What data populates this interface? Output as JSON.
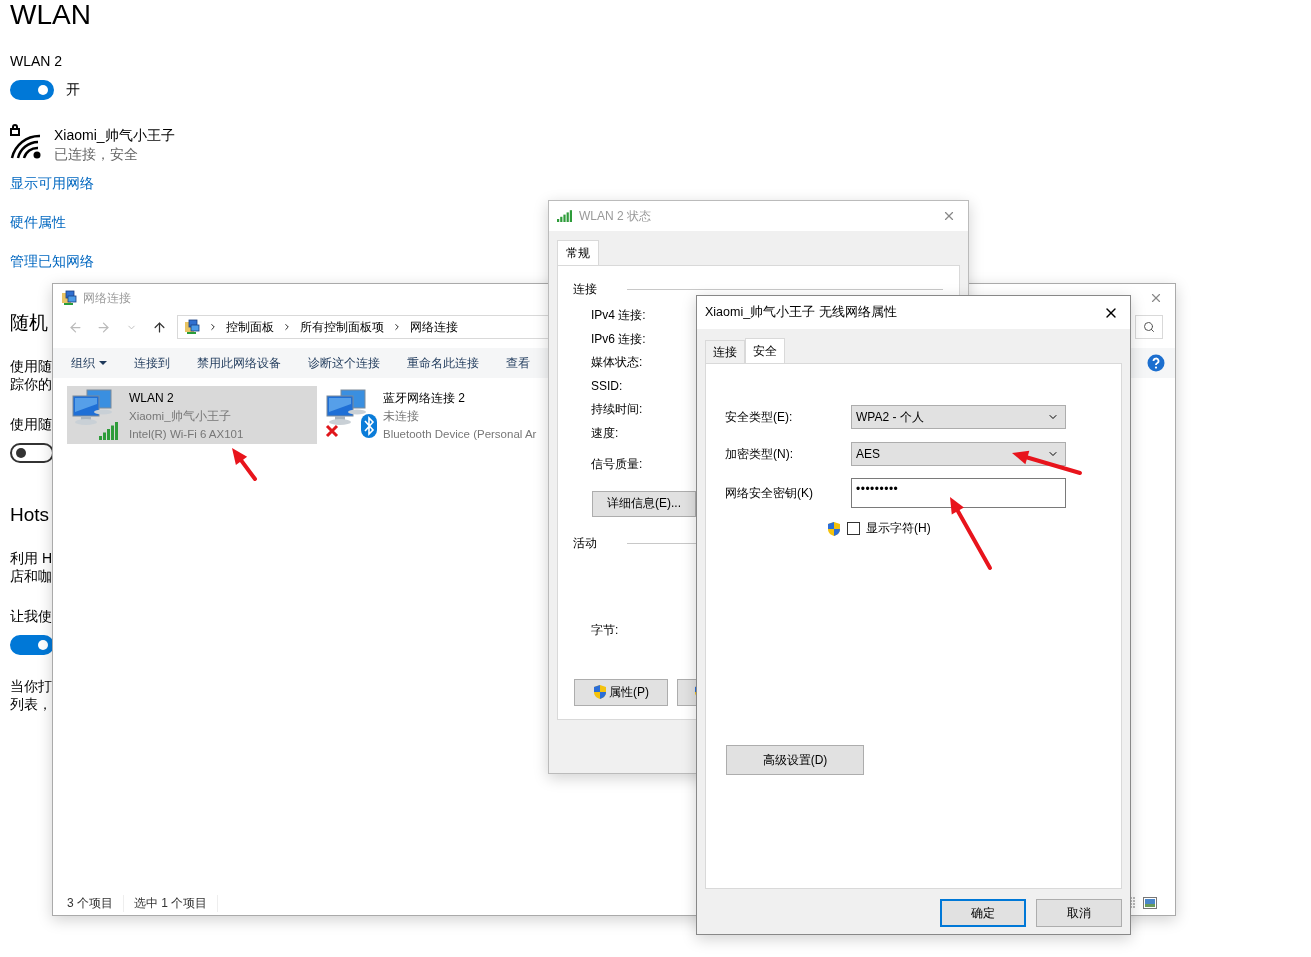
{
  "settings": {
    "items": [
      {
        "kind": "heading",
        "text": "WLAN"
      },
      {
        "kind": "label",
        "text": "WLAN 2"
      },
      {
        "kind": "toggle",
        "on": true,
        "label": "开"
      },
      {
        "kind": "network",
        "ssid": "Xiaomi_帅气小王子",
        "status": "已连接，安全"
      },
      {
        "kind": "link",
        "text": "显示可用网络"
      },
      {
        "kind": "link",
        "text": "硬件属性"
      },
      {
        "kind": "link",
        "text": "管理已知网络"
      },
      {
        "kind": "subheading",
        "text": "随机"
      },
      {
        "kind": "paragraph",
        "lines": [
          "使用随",
          "踪你的"
        ]
      },
      {
        "kind": "paragraph",
        "lines": [
          "使用随"
        ]
      },
      {
        "kind": "toggle",
        "on": false
      },
      {
        "kind": "subheading",
        "text": "Hots"
      },
      {
        "kind": "paragraph",
        "lines": [
          "利用 H",
          "店和咖"
        ]
      },
      {
        "kind": "paragraph",
        "lines": [
          "让我使"
        ]
      },
      {
        "kind": "toggle",
        "on": true
      },
      {
        "kind": "paragraph",
        "lines": [
          "当你打",
          "列表，"
        ]
      }
    ]
  },
  "network_connections": {
    "title": "网络连接",
    "breadcrumbs": [
      "控制面板",
      "所有控制面板项",
      "网络连接"
    ],
    "toolbar": [
      {
        "label": "组织",
        "dropdown": true
      },
      {
        "label": "连接到",
        "dropdown": false
      },
      {
        "label": "禁用此网络设备",
        "dropdown": false
      },
      {
        "label": "诊断这个连接",
        "dropdown": false
      },
      {
        "label": "重命名此连接",
        "dropdown": false
      },
      {
        "label": "查看",
        "dropdown": false
      }
    ],
    "connections": [
      {
        "kind": "wifi",
        "name": "WLAN 2",
        "detail": "Xiaomi_帅气小王子",
        "device": "Intel(R) Wi-Fi 6 AX101",
        "selected": true,
        "connected": true
      },
      {
        "kind": "bluetooth",
        "name": "蓝牙网络连接 2",
        "detail": "未连接",
        "device": "Bluetooth Device (Personal Ar",
        "selected": false,
        "connected": false
      }
    ],
    "status_bar": [
      "3 个项目",
      "选中 1 个项目"
    ]
  },
  "status_window": {
    "title": "WLAN 2 状态",
    "tabs": [
      {
        "label": "常规",
        "selected": true
      }
    ],
    "connection": {
      "heading": "连接",
      "fields": [
        "IPv4 连接:",
        "IPv6 连接:",
        "媒体状态:",
        "SSID:",
        "持续时间:",
        "速度:",
        "信号质量:"
      ]
    },
    "details_button": "详细信息(E)...",
    "activity": {
      "heading": "活动",
      "bytes_label": "字节:"
    },
    "buttons": [
      {
        "label": "属性(P)"
      }
    ]
  },
  "properties_dialog": {
    "title": "Xiaomi_帅气小王子 无线网络属性",
    "tabs": [
      {
        "label": "连接",
        "selected": false
      },
      {
        "label": "安全",
        "selected": true
      }
    ],
    "security_type": {
      "label": "安全类型(E):",
      "value": "WPA2 - 个人"
    },
    "encryption_type": {
      "label": "加密类型(N):",
      "value": "AES"
    },
    "key": {
      "label": "网络安全密钥(K)",
      "value": "•••••••••"
    },
    "show_characters": {
      "label": "显示字符(H)",
      "checked": false
    },
    "advanced_button": "高级设置(D)",
    "buttons": [
      {
        "label": "确定",
        "default": true
      },
      {
        "label": "取消",
        "default": false
      }
    ]
  }
}
